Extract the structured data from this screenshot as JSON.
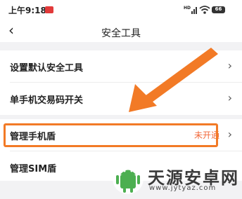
{
  "statusbar": {
    "time": "上午9:18",
    "signal_text": "HD",
    "battery": "66"
  },
  "header": {
    "title": "安全工具"
  },
  "menu": {
    "items": [
      {
        "label": "设置默认安全工具"
      },
      {
        "label": "单手机交易码开关"
      },
      {
        "label": "管理手机盾",
        "status": "未开通"
      },
      {
        "label": "管理SIM盾"
      }
    ]
  },
  "watermark": {
    "title": "天源安卓网",
    "url": "www.jytyaz.com"
  },
  "colors": {
    "accent": "#f27a26",
    "status_text": "#f26a3c"
  }
}
